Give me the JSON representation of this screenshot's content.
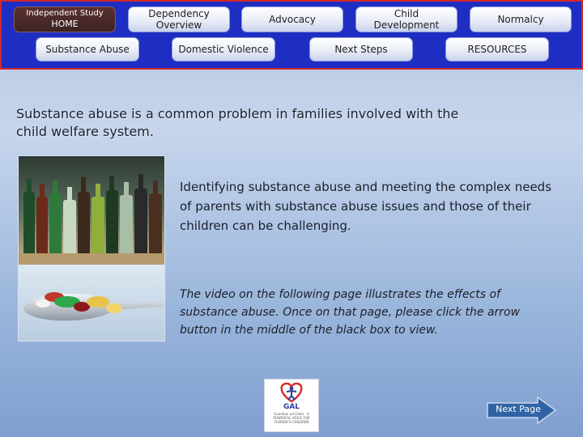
{
  "nav": {
    "home": {
      "line1": "Independent Study",
      "line2": "HOME"
    },
    "dependency_overview": {
      "line1": "Dependency",
      "line2": "Overview"
    },
    "advocacy": "Advocacy",
    "child_development": {
      "line1": "Child",
      "line2": "Development"
    },
    "normalcy": "Normalcy",
    "substance_abuse": "Substance Abuse",
    "domestic_violence": "Domestic Violence",
    "next_steps": "Next Steps",
    "resources": "RESOURCES"
  },
  "content": {
    "heading": "Substance abuse is a common problem in families involved with the child welfare system.",
    "paragraph1": "Identifying substance abuse and meeting the complex needs of parents with substance abuse issues and those of their children can be challenging.",
    "paragraph2": "The video on the following page illustrates the effects of substance abuse.  Once on that page, please click the arrow button in the middle of the black box to view."
  },
  "logo": {
    "text": "GAL",
    "fine_print": "Guardian ad Litem · A POWERFUL VOICE FOR FLORIDA'S CHILDREN"
  },
  "next_page": {
    "label": "Next Page"
  },
  "colors": {
    "nav_background": "#1f2ec2",
    "nav_border": "#d22929",
    "active_tab": "#4a2a2a",
    "next_button": "#2f63a6"
  }
}
